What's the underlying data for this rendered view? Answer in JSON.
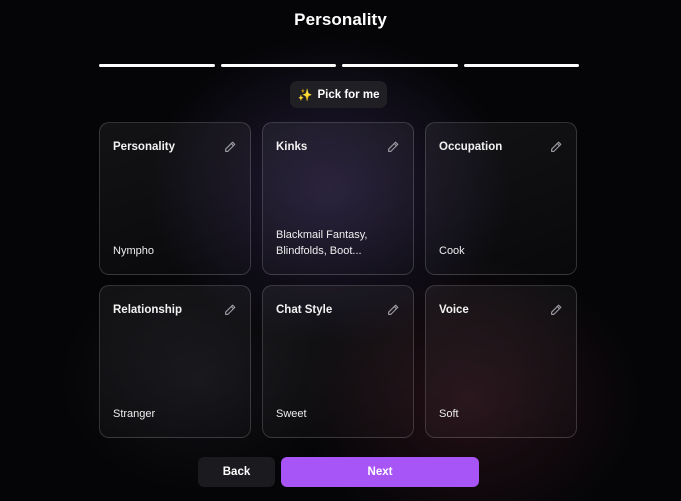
{
  "header": {
    "title": "Personality"
  },
  "progress": {
    "steps_total": 4,
    "steps_completed": 4
  },
  "pick_button": {
    "icon": "sparkles-icon",
    "label": "Pick for me"
  },
  "cards": [
    {
      "label": "Personality",
      "value": "Nympho"
    },
    {
      "label": "Kinks",
      "value": "Blackmail Fantasy, Blindfolds, Boot..."
    },
    {
      "label": "Occupation",
      "value": "Cook"
    },
    {
      "label": "Relationship",
      "value": "Stranger"
    },
    {
      "label": "Chat Style",
      "value": "Sweet"
    },
    {
      "label": "Voice",
      "value": "Soft"
    }
  ],
  "footer": {
    "back_label": "Back",
    "next_label": "Next"
  },
  "colors": {
    "accent": "#a855f7",
    "background": "#050507"
  }
}
